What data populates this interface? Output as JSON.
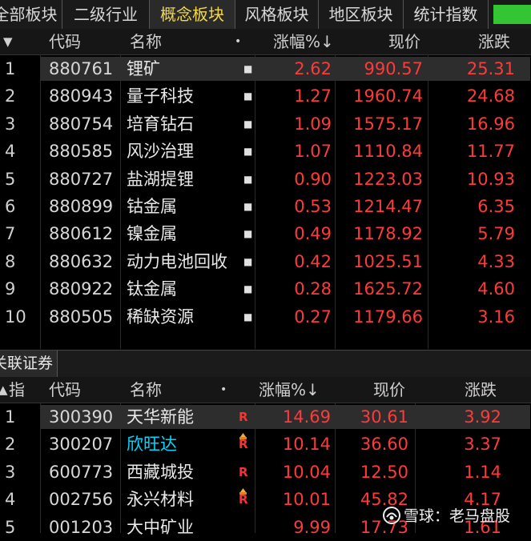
{
  "tabs": [
    {
      "label": "全部板块"
    },
    {
      "label": "二级行业"
    },
    {
      "label": "概念板块",
      "active": true
    },
    {
      "label": "风格板块"
    },
    {
      "label": "地区板块"
    },
    {
      "label": "统计指数"
    }
  ],
  "top_header": {
    "menu_arrow": "▼",
    "code": "代码",
    "name": "名称",
    "dot": "•",
    "pct": "涨幅%",
    "sort_arrow": "↓",
    "price": "现价",
    "change": "涨跌"
  },
  "top_rows": [
    {
      "idx": "1",
      "code": "880761",
      "name": "锂矿",
      "pct": "2.62",
      "price": "990.57",
      "change": "25.31"
    },
    {
      "idx": "2",
      "code": "880943",
      "name": "量子科技",
      "pct": "1.27",
      "price": "1960.74",
      "change": "24.68"
    },
    {
      "idx": "3",
      "code": "880754",
      "name": "培育钻石",
      "pct": "1.09",
      "price": "1575.17",
      "change": "16.96"
    },
    {
      "idx": "4",
      "code": "880585",
      "name": "风沙治理",
      "pct": "1.07",
      "price": "1110.84",
      "change": "11.77"
    },
    {
      "idx": "5",
      "code": "880727",
      "name": "盐湖提锂",
      "pct": "0.90",
      "price": "1223.03",
      "change": "10.93"
    },
    {
      "idx": "6",
      "code": "880899",
      "name": "钴金属",
      "pct": "0.53",
      "price": "1214.47",
      "change": "6.35"
    },
    {
      "idx": "7",
      "code": "880612",
      "name": "镍金属",
      "pct": "0.49",
      "price": "1178.92",
      "change": "5.79"
    },
    {
      "idx": "8",
      "code": "880632",
      "name": "动力电池回收",
      "pct": "0.42",
      "price": "1025.51",
      "change": "4.33"
    },
    {
      "idx": "9",
      "code": "880922",
      "name": "钛金属",
      "pct": "0.28",
      "price": "1625.72",
      "change": "4.60"
    },
    {
      "idx": "10",
      "code": "880505",
      "name": "稀缺资源",
      "pct": "0.27",
      "price": "1179.66",
      "change": "3.16"
    }
  ],
  "section_tab": "关联证券",
  "bottom_header": {
    "menu_arrow": "▲",
    "idx": "指",
    "code": "代码",
    "name": "名称",
    "dot": "•",
    "pct": "涨幅%",
    "sort_arrow": "↓",
    "price": "现价",
    "change": "涨跌"
  },
  "bottom_rows": [
    {
      "idx": "1",
      "code": "300390",
      "name": "天华新能",
      "mark": "R",
      "pct": "14.69",
      "price": "30.61",
      "change": "3.92"
    },
    {
      "idx": "2",
      "code": "300207",
      "name": "欣旺达",
      "mark": "R",
      "hat": true,
      "cyan": true,
      "pct": "10.14",
      "price": "36.60",
      "change": "3.37"
    },
    {
      "idx": "3",
      "code": "600773",
      "name": "西藏城投",
      "mark": "R",
      "pct": "10.04",
      "price": "12.50",
      "change": "1.14"
    },
    {
      "idx": "4",
      "code": "002756",
      "name": "永兴材料",
      "mark": "R",
      "hat": true,
      "pct": "10.01",
      "price": "45.82",
      "change": "4.17"
    },
    {
      "idx": "5",
      "code": "001203",
      "name": "大中矿业",
      "pct": "9.99",
      "price": "17.73",
      "change": "1.61"
    }
  ],
  "watermark": "雪球：老马盘股",
  "colors": {
    "up": "#ff3a3a",
    "active_tab": "#f2d84a",
    "cyan_name": "#00d8ff",
    "green_tab": "#34c534"
  }
}
